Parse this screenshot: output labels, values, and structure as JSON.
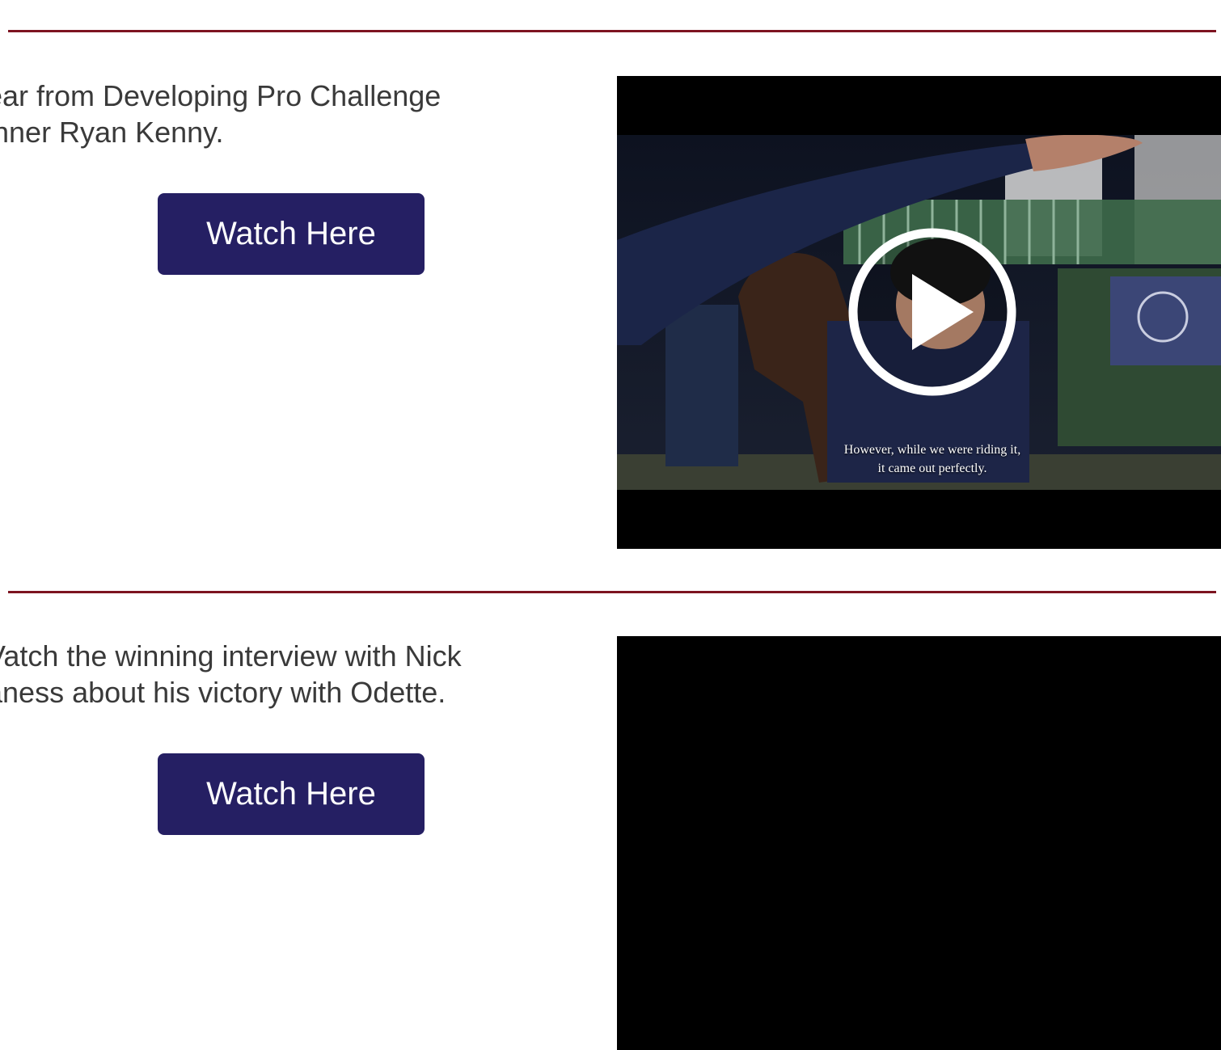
{
  "sections": [
    {
      "text_lines": [
        "ear from Developing Pro Challenge",
        "inner Ryan Kenny."
      ],
      "button_label": "Watch Here",
      "video": {
        "caption_lines": [
          "However, while we were riding it,",
          "it came out perfectly."
        ],
        "has_thumbnail": true
      }
    },
    {
      "text_lines": [
        "Vatch the winning interview with Nick",
        "aness about his victory with Odette."
      ],
      "button_label": "Watch Here",
      "video": {
        "has_thumbnail": false
      }
    }
  ],
  "colors": {
    "divider": "#7d1420",
    "button_bg": "#251f63",
    "button_text": "#ffffff",
    "body_text": "#3a3a3a",
    "video_bg": "#000000"
  },
  "icons": {
    "play": "play-icon"
  }
}
